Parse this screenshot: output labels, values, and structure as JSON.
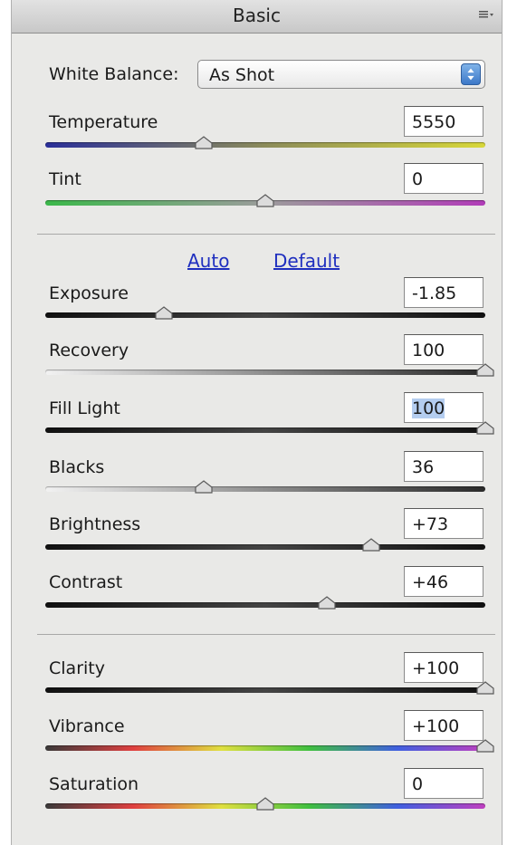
{
  "panel": {
    "title": "Basic"
  },
  "white_balance": {
    "label": "White Balance:",
    "value": "As Shot"
  },
  "links": {
    "auto": "Auto",
    "default": "Default"
  },
  "sliders": [
    {
      "id": "temperature",
      "label": "Temperature",
      "value": "5550",
      "position": 0.36
    },
    {
      "id": "tint",
      "label": "Tint",
      "value": "0",
      "position": 0.5
    },
    {
      "id": "exposure",
      "label": "Exposure",
      "value": "-1.85",
      "position": 0.27
    },
    {
      "id": "recovery",
      "label": "Recovery",
      "value": "100",
      "position": 1.0
    },
    {
      "id": "fill-light",
      "label": "Fill Light",
      "value": "100",
      "position": 1.0
    },
    {
      "id": "blacks",
      "label": "Blacks",
      "value": "36",
      "position": 0.36
    },
    {
      "id": "brightness",
      "label": "Brightness",
      "value": "+73",
      "position": 0.74
    },
    {
      "id": "contrast",
      "label": "Contrast",
      "value": "+46",
      "position": 0.64
    },
    {
      "id": "clarity",
      "label": "Clarity",
      "value": "+100",
      "position": 1.0
    },
    {
      "id": "vibrance",
      "label": "Vibrance",
      "value": "+100",
      "position": 1.0
    },
    {
      "id": "saturation",
      "label": "Saturation",
      "value": "0",
      "position": 0.5
    }
  ],
  "colors": {
    "temperature_track": [
      "#2a2f9a",
      "#8c8c5a",
      "#d8d83a"
    ],
    "tint_track": [
      "#3bb84a",
      "#9c9c9c",
      "#b13cb8"
    ],
    "spectrum_track": [
      "#3a3a3a",
      "#e04040",
      "#e0e040",
      "#40c040",
      "#4060e0",
      "#c040c0"
    ],
    "selection": "#b4cdf0",
    "link": "#1f2fbf"
  }
}
